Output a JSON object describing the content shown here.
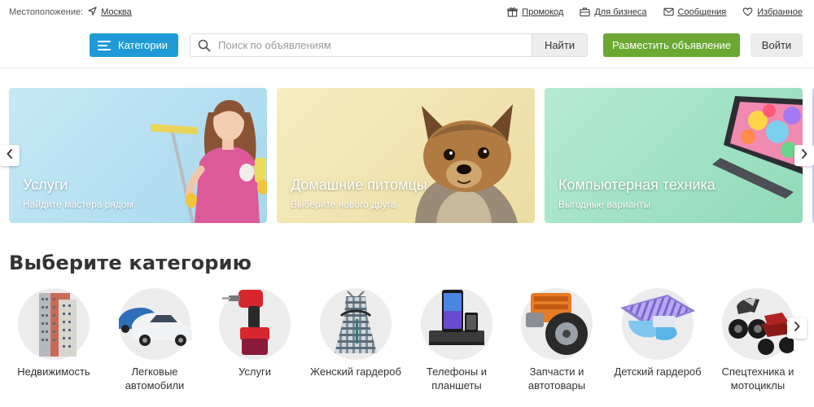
{
  "location": {
    "label": "Местоположение:",
    "city": "Москва"
  },
  "top_links": [
    {
      "icon": "gift-icon",
      "label": "Промокод"
    },
    {
      "icon": "briefcase-icon",
      "label": "Для бизнеса"
    },
    {
      "icon": "envelope-icon",
      "label": "Сообщения"
    },
    {
      "icon": "heart-icon",
      "label": "Избранное"
    }
  ],
  "header": {
    "categories_label": "Категории",
    "search_placeholder": "Поиск по объявлениям",
    "search_button": "Найти",
    "post_button": "Разместить объявление",
    "login_button": "Войти"
  },
  "banners": [
    {
      "title": "Услуги",
      "subtitle": "Найдите мастера рядом"
    },
    {
      "title": "Домашние питомцы",
      "subtitle": "Выберите нового друга"
    },
    {
      "title": "Компьютерная техника",
      "subtitle": "Выгодные варианты"
    }
  ],
  "categories_section": {
    "title": "Выберите категорию",
    "items": [
      {
        "label": "Недвижимость",
        "icon": "apartment-building-icon"
      },
      {
        "label": "Легковые автомобили",
        "icon": "cars-icon"
      },
      {
        "label": "Услуги",
        "icon": "drill-icon"
      },
      {
        "label": "Женский гардероб",
        "icon": "dress-icon"
      },
      {
        "label": "Телефоны и планшеты",
        "icon": "phone-icon"
      },
      {
        "label": "Запчасти и автотовары",
        "icon": "engine-part-icon"
      },
      {
        "label": "Детский гардероб",
        "icon": "kids-clothes-icon"
      },
      {
        "label": "Спецтехника и мотоциклы",
        "icon": "motorcycle-icon"
      }
    ]
  },
  "colors": {
    "primary_blue": "#1e9bd7",
    "post_green": "#6aa832",
    "text_dark": "#333333"
  }
}
